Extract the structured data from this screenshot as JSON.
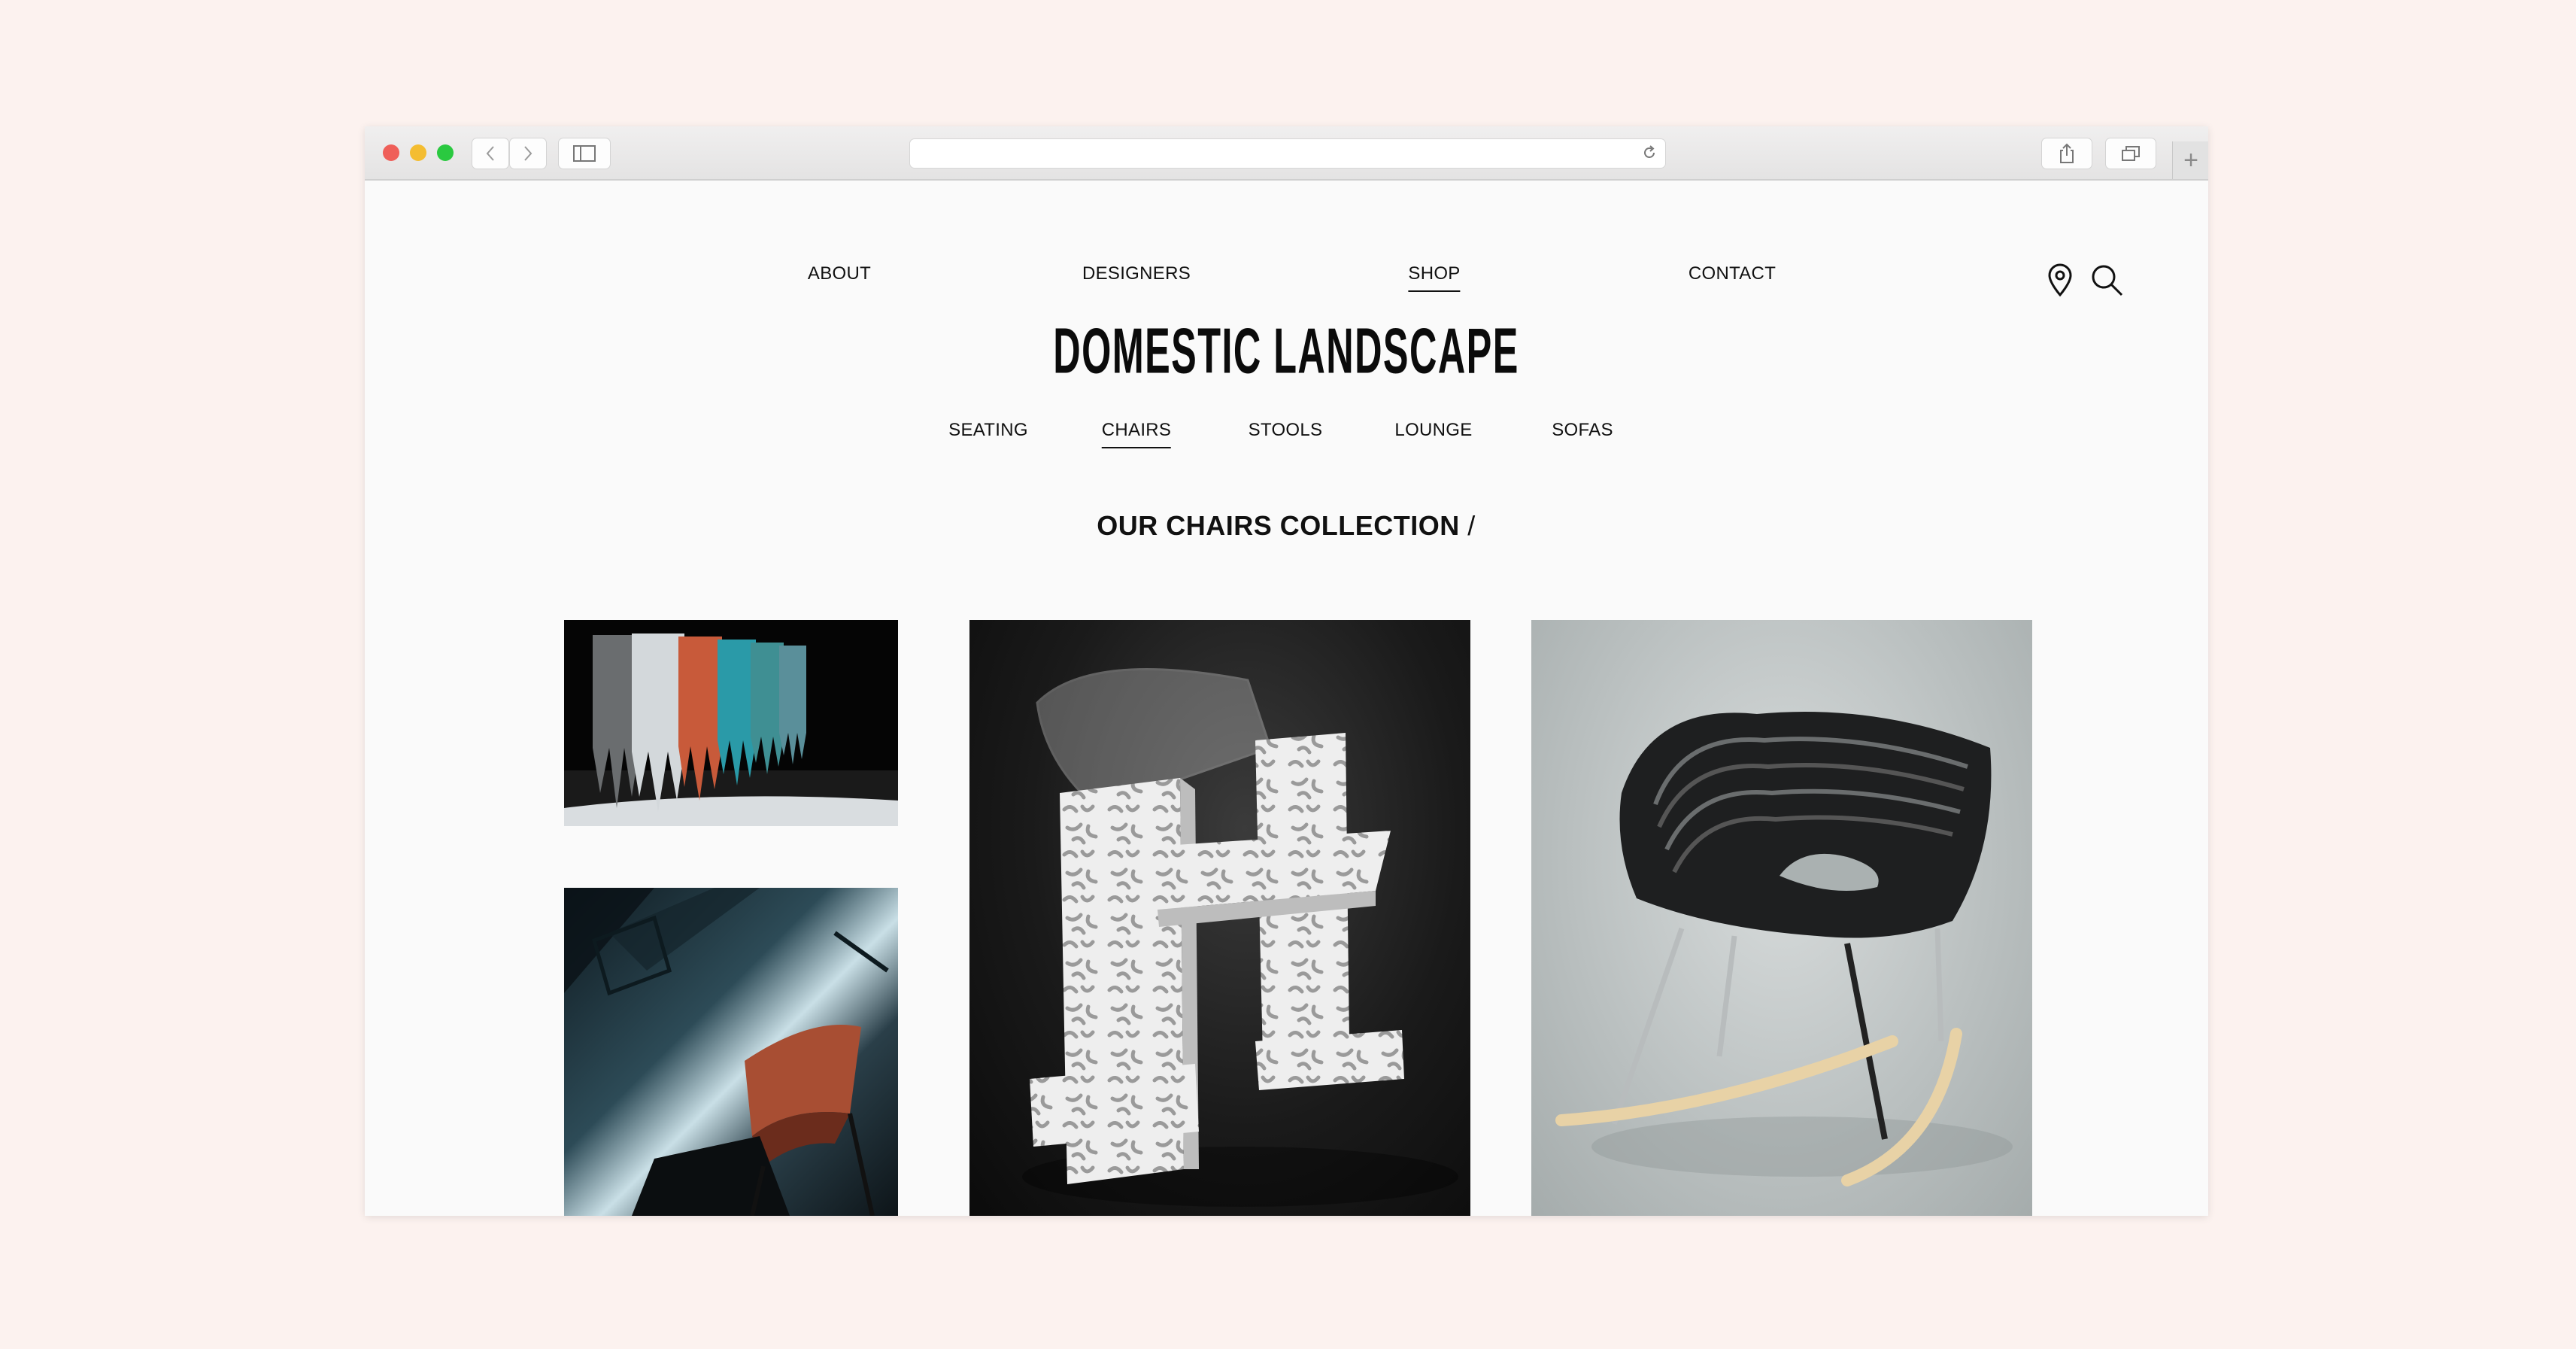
{
  "browser": {
    "toolbar_icons": [
      "back-icon",
      "forward-icon",
      "sidebar-icon",
      "reload-icon",
      "share-icon",
      "tabs-icon",
      "plus-icon"
    ],
    "new_tab_glyph": "+"
  },
  "nav": {
    "items": [
      {
        "label": "ABOUT"
      },
      {
        "label": "DESIGNERS"
      },
      {
        "label": "SHOP",
        "active": true
      },
      {
        "label": "CONTACT"
      }
    ],
    "icons": [
      "location-pin-icon",
      "search-icon"
    ]
  },
  "brand": {
    "logo": "DOMESTIC LANDSCAPE"
  },
  "categories": {
    "items": [
      {
        "label": "SEATING"
      },
      {
        "label": "CHAIRS",
        "active": true
      },
      {
        "label": "STOOLS"
      },
      {
        "label": "LOUNGE"
      },
      {
        "label": "SOFAS"
      }
    ]
  },
  "collection": {
    "title": "OUR CHAIRS COLLECTION",
    "suffix": " /"
  },
  "colors": {
    "page_background": "#fcf2ef",
    "content_background": "#fafafa",
    "text": "#111111"
  }
}
